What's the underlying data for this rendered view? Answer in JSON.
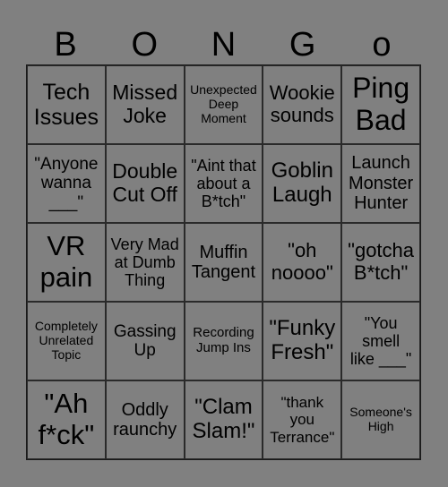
{
  "header": [
    "B",
    "O",
    "N",
    "G",
    "o"
  ],
  "cells": [
    [
      "Tech\nIssues",
      "Missed\nJoke",
      "Unexpected\nDeep\nMoment",
      "Wookie\nsounds",
      "Ping\nBad"
    ],
    [
      "\"Anyone\nwanna\n___\"",
      "Double\nCut Off",
      "\"Aint that\nabout a\nB*tch\"",
      "Goblin\nLaugh",
      "Launch\nMonster\nHunter"
    ],
    [
      "VR\npain",
      "Very Mad\nat Dumb\nThing",
      "Muffin\nTangent",
      "\"oh\nnoooo\"",
      "\"gotcha\nB*tch\""
    ],
    [
      "Completely\nUnrelated\nTopic",
      "Gassing\nUp",
      "Recording\nJump Ins",
      "\"Funky\nFresh\"",
      "\"You\nsmell\nlike ___\""
    ],
    [
      "\"Ah\nf*ck\"",
      "Oddly\nraunchy",
      "\"Clam\nSlam!\"",
      "\"thank\nyou\nTerrance\"",
      "Someone's\nHigh"
    ]
  ],
  "colors": {
    "background": "#808080",
    "grid_line": "#1a1a1a",
    "text": "#000000"
  }
}
